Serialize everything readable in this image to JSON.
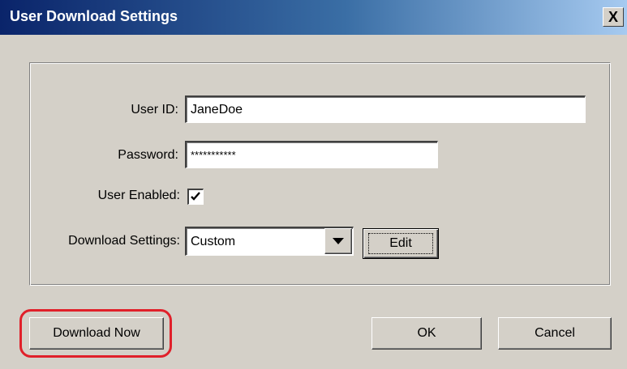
{
  "window": {
    "title": "User Download Settings",
    "close_label": "X"
  },
  "form": {
    "user_id_label": "User ID:",
    "user_id_value": "JaneDoe",
    "password_label": "Password:",
    "password_value": "***********",
    "user_enabled_label": "User Enabled:",
    "user_enabled_checked": true,
    "download_settings_label": "Download Settings:",
    "download_settings_value": "Custom",
    "edit_button_label": "Edit"
  },
  "buttons": {
    "download_now": "Download Now",
    "ok": "OK",
    "cancel": "Cancel"
  },
  "colors": {
    "dialog_bg": "#d4d0c8",
    "title_bar_start": "#0a246a",
    "highlight": "#e0202a"
  },
  "icons": {
    "close": "close-icon",
    "checkmark": "checkmark-icon",
    "dropdown": "chevron-down-icon"
  }
}
